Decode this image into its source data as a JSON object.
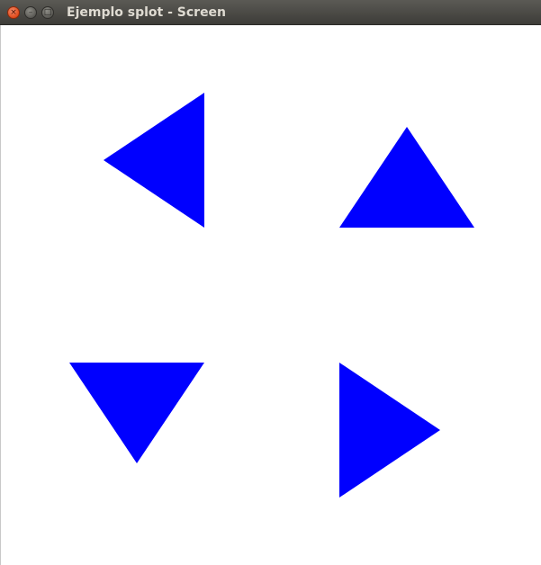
{
  "window": {
    "title": "Ejemplo splot - Screen",
    "close_glyph": "×",
    "minimize_glyph": "–",
    "maximize_glyph": "□"
  },
  "icons": {
    "close": "close-icon",
    "minimize": "minimize-icon",
    "maximize": "maximize-icon"
  },
  "colors": {
    "marker_fill": "#0000ff",
    "canvas_background": "#ffffff",
    "titlebar": "#45443f"
  },
  "plot": {
    "markers": [
      {
        "name": "triangle-left",
        "direction": "left"
      },
      {
        "name": "triangle-up",
        "direction": "up"
      },
      {
        "name": "triangle-down",
        "direction": "down"
      },
      {
        "name": "triangle-right",
        "direction": "right"
      }
    ]
  }
}
